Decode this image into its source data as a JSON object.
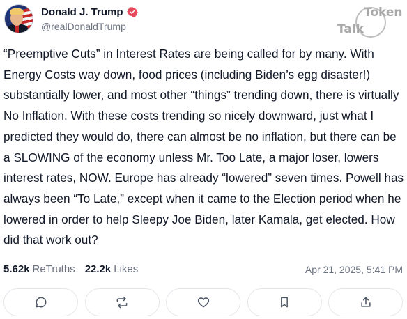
{
  "author": {
    "display_name": "Donald J. Trump",
    "handle": "@realDonaldTrump",
    "verified_icon": "verified-badge-icon",
    "verified_color": "#e5495c"
  },
  "watermark": {
    "token": "Token",
    "talk": "Talk"
  },
  "post": {
    "text": "“Preemptive Cuts” in Interest Rates are being called for by many. With Energy Costs way down, food prices (including Biden’s egg disaster!) substantially lower, and most other “things” trending down, there is virtually No Inflation. With these costs trending so nicely downward, just what I predicted they would do, there can almost be no inflation, but there can be a SLOWING of the economy unless Mr. Too Late, a major loser, lowers interest rates, NOW. Europe has already “lowered” seven times. Powell has always been “To Late,” except when it came to the Election period when he lowered in order to help Sleepy Joe Biden, later Kamala, get elected. How did that work out?"
  },
  "stats": {
    "retruths_count": "5.62k",
    "retruths_label": "ReTruths",
    "likes_count": "22.2k",
    "likes_label": "Likes",
    "timestamp": "Apr 21, 2025, 5:41 PM"
  },
  "actions": [
    {
      "name": "reply",
      "icon": "comment-icon"
    },
    {
      "name": "retruth",
      "icon": "repost-icon"
    },
    {
      "name": "like",
      "icon": "heart-icon"
    },
    {
      "name": "bookmark",
      "icon": "bookmark-icon"
    },
    {
      "name": "share",
      "icon": "share-icon"
    }
  ]
}
